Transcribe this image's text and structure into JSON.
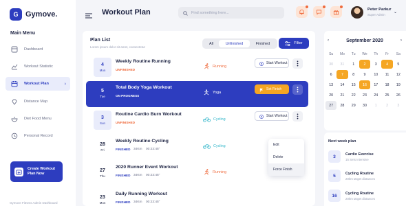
{
  "app": {
    "logo_mark": "G",
    "logo_text": "Gymove.",
    "footer": "Gymove Fitness Admin Dashboard"
  },
  "sidebar": {
    "title": "Main Menu",
    "items": [
      {
        "label": "Dashboard",
        "icon": "dashboard-icon"
      },
      {
        "label": "Workout Statistic",
        "icon": "chart-icon"
      },
      {
        "label": "Workout Plan",
        "icon": "calendar-icon",
        "active": true
      },
      {
        "label": "Distance Map",
        "icon": "map-pin-icon"
      },
      {
        "label": "Diet Food Menu",
        "icon": "food-icon"
      },
      {
        "label": "Personal Record",
        "icon": "record-icon"
      }
    ],
    "create_button": "Create Workout\nPlan Now"
  },
  "header": {
    "title": "Workout Plan",
    "search_placeholder": "Find something here...",
    "profile_name": "Peter Parkur",
    "profile_role": "Super Admin"
  },
  "plan": {
    "title": "Plan List",
    "subtitle": "Lorem ipsum dolor sit amet, consectetur",
    "tabs": [
      "All",
      "Unfinished",
      "Finished"
    ],
    "active_tab": "Unfinished",
    "filter_label": "Filter",
    "rows": [
      {
        "day": "4",
        "dow": "Mon",
        "title": "Weekly Routine Running",
        "status": "UNFINISHED",
        "category": "Running",
        "action": "Start Workout"
      },
      {
        "day": "5",
        "dow": "Tue",
        "title": "Total Body Yoga Workout",
        "status": "ON PROGRESS",
        "category": "Yoga",
        "action": "Set Finish"
      },
      {
        "day": "3",
        "dow": "Sun",
        "title": "Routine Cardio Burn Workout",
        "status": "UNFINISHED",
        "category": "Cycling",
        "action": "Start Workout"
      },
      {
        "day": "28",
        "dow": "Fri",
        "title": "Weekly Routine Cycling",
        "status": "FINISHED",
        "distance": "34Km",
        "time": "00:23:45\"",
        "category": "Cycling"
      },
      {
        "day": "27",
        "dow": "Thu",
        "title": "2020 Runner Event Workout",
        "status": "FINISHED",
        "distance": "34Km",
        "time": "00:23:45\"",
        "category": "Running"
      },
      {
        "day": "23",
        "dow": "Mon",
        "title": "Daily Running Workout",
        "status": "FINISHED",
        "distance": "34Km",
        "time": "00:23:45\"",
        "category": ""
      }
    ],
    "context_menu": [
      "Edit",
      "Delete",
      "Force Finish"
    ]
  },
  "calendar": {
    "month": "September 2020",
    "dows": [
      "Su",
      "Mo",
      "Tu",
      "We",
      "Th",
      "Fr",
      "Sa"
    ],
    "weeks": [
      [
        "30",
        "31",
        "1",
        "2",
        "3",
        "4",
        "5"
      ],
      [
        "6",
        "7",
        "8",
        "9",
        "10",
        "11",
        "12"
      ],
      [
        "13",
        "14",
        "15",
        "16",
        "17",
        "18",
        "19"
      ],
      [
        "20",
        "21",
        "22",
        "23",
        "24",
        "25",
        "26"
      ],
      [
        "27",
        "28",
        "29",
        "30",
        "1",
        "2",
        "3"
      ]
    ],
    "highlighted": [
      "2",
      "4",
      "7",
      "16"
    ],
    "today": "27",
    "accent": "#f5a623"
  },
  "next_week": {
    "title": "Next week plan",
    "items": [
      {
        "num": "3",
        "name": "Cardio Exercise",
        "sub": "15 Sets   Intensive"
      },
      {
        "num": "5",
        "name": "Cycling Routine",
        "sub": "20km target distances"
      },
      {
        "num": "16",
        "name": "Cycling Routine",
        "sub": "20km target distances"
      }
    ]
  },
  "colors": {
    "primary": "#2d3dbf",
    "orange": "#ef6b3d",
    "amber": "#f5a623",
    "cyan": "#2fb5c9"
  }
}
